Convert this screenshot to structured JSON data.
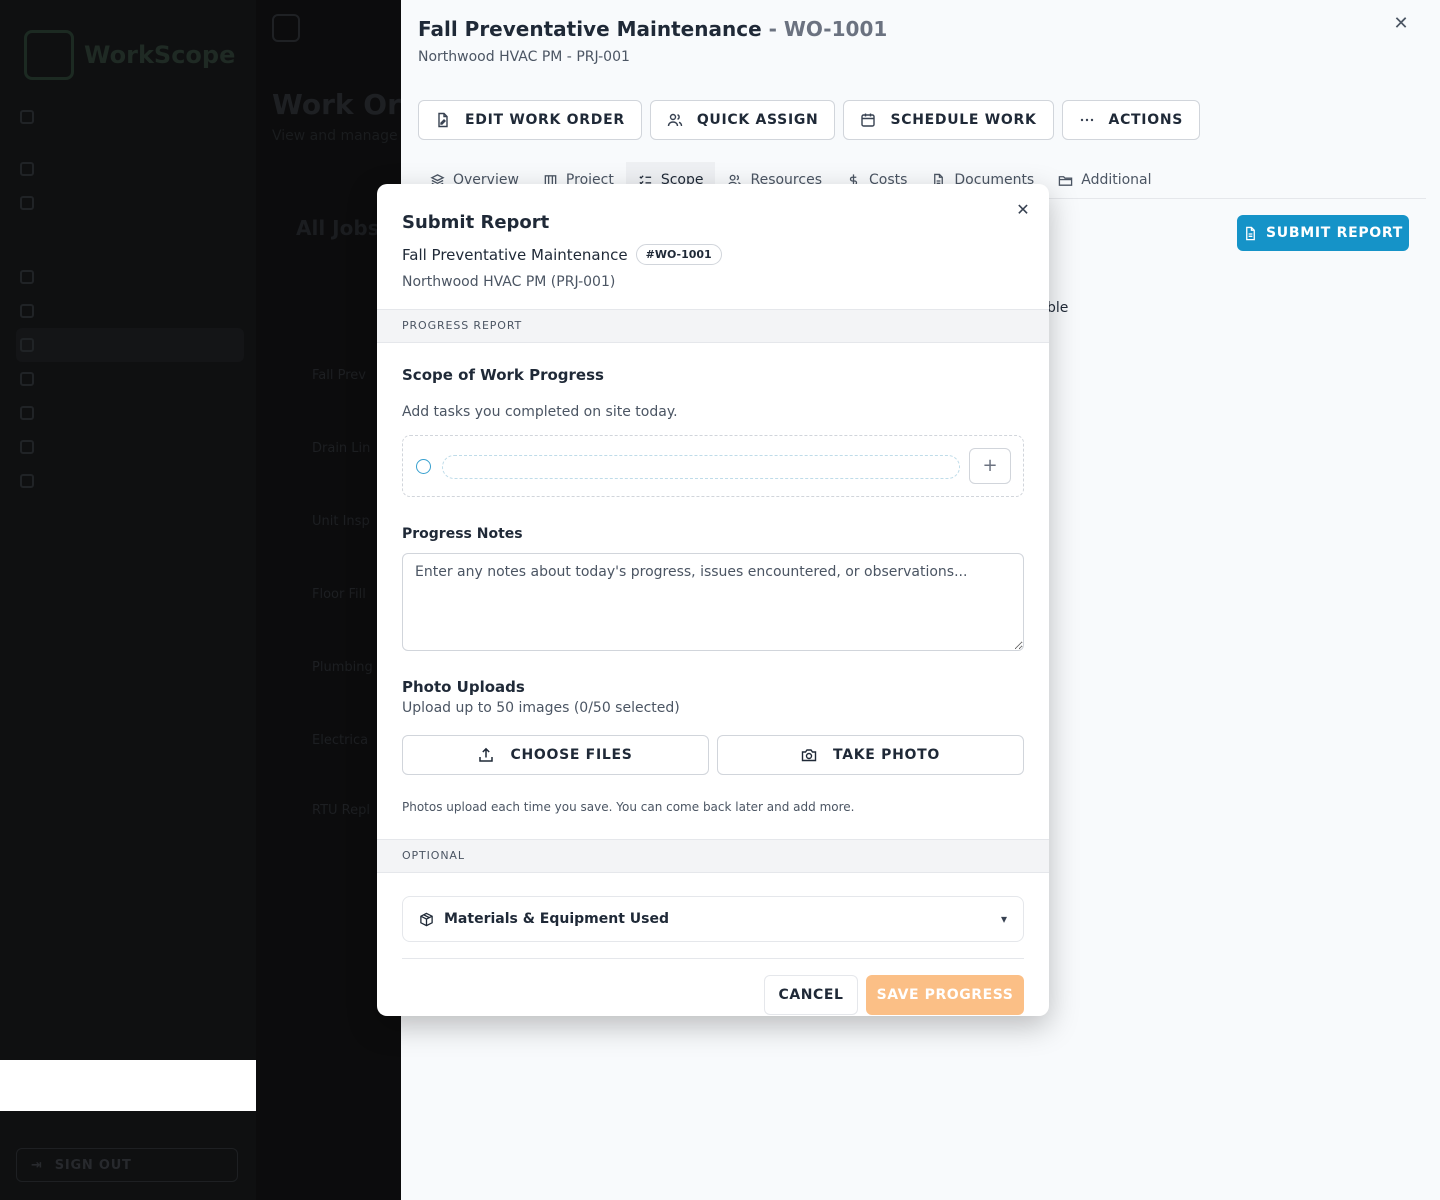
{
  "background": {
    "logo": "WorkScope",
    "signout": "SIGN OUT",
    "main_title": "Work Or",
    "main_subtitle": "View and manage",
    "card_title": "All Jobs",
    "rows": [
      "Fall Prev",
      "Drain Lin",
      "Unit Insp",
      "Floor Fill",
      "Plumbing",
      "Electrica",
      "RTU Repl"
    ]
  },
  "drawer": {
    "title": "Fall Preventative Maintenance",
    "title_sep": " - ",
    "work_order_id": "WO-1001",
    "subtitle": "Northwood HVAC PM - PRJ-001",
    "toolbar": {
      "edit": "EDIT WORK ORDER",
      "assign": "QUICK ASSIGN",
      "schedule": "SCHEDULE WORK",
      "actions": "ACTIONS"
    },
    "tabs": {
      "overview": "Overview",
      "project": "Project",
      "scope": "Scope",
      "resources": "Resources",
      "costs": "Costs",
      "documents": "Documents",
      "additional": "Additional"
    },
    "submit_report": "SUBMIT REPORT",
    "peek_text": "ble"
  },
  "modal": {
    "title": "Submit Report",
    "work_order_name": "Fall Preventative Maintenance",
    "work_order_badge": "#WO-1001",
    "project": "Northwood HVAC PM (PRJ-001)",
    "section_progress": "PROGRESS REPORT",
    "scope_heading": "Scope of Work Progress",
    "scope_desc": "Add tasks you completed on site today.",
    "task_input_value": "",
    "notes_label": "Progress Notes",
    "notes_placeholder": "Enter any notes about today's progress, issues encountered, or observations...",
    "photo_heading": "Photo Uploads",
    "photo_desc": "Upload up to 50 images (0/50 selected)",
    "choose_files": "CHOOSE FILES",
    "take_photo": "TAKE PHOTO",
    "photo_hint": "Photos upload each time you save. You can come back later and add more.",
    "section_optional": "OPTIONAL",
    "materials": "Materials & Equipment Used",
    "cancel": "CANCEL",
    "save": "SAVE PROGRESS"
  },
  "colors": {
    "accent_blue": "#1593c8",
    "save_orange": "#fbbf86"
  }
}
